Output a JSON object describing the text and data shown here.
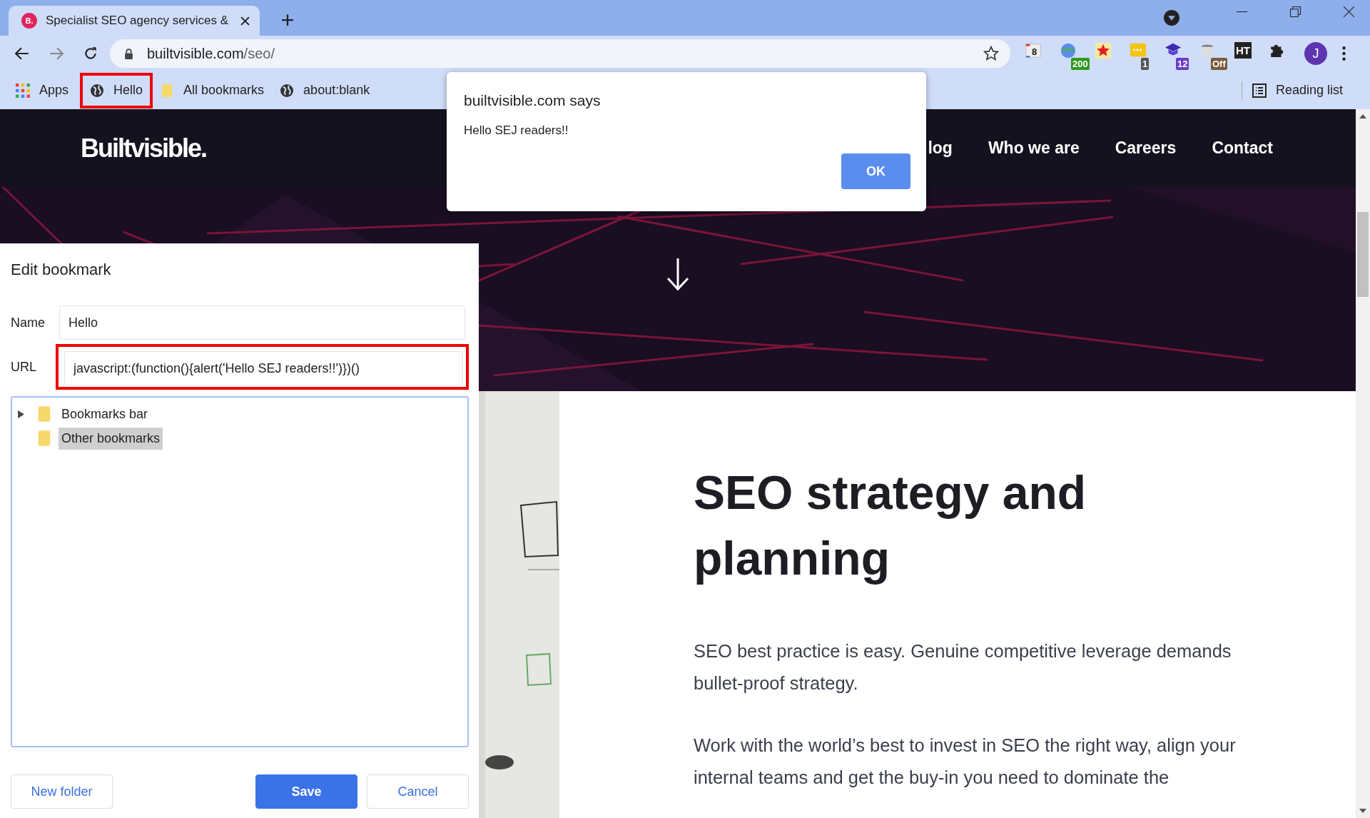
{
  "tabs": [
    {
      "favicon": "B.",
      "title": "Specialist SEO agency services &",
      "selected": true
    }
  ],
  "address_bar": {
    "domain": "builtvisible.com",
    "path": "/seo/"
  },
  "extensions": [
    {
      "kind": "calendar",
      "badge": "8"
    },
    {
      "kind": "globe",
      "badge": "200"
    },
    {
      "kind": "star"
    },
    {
      "kind": "chat",
      "badge": "1"
    },
    {
      "kind": "cap",
      "badge": "12"
    },
    {
      "kind": "cup",
      "badge": "Off"
    },
    {
      "kind": "ht",
      "label": "HT"
    },
    {
      "kind": "puzzle"
    }
  ],
  "profile": {
    "initial": "J"
  },
  "bookmarks_bar": {
    "items": [
      {
        "kind": "apps",
        "label": "Apps",
        "highlighted": false
      },
      {
        "kind": "page",
        "label": "Hello",
        "highlighted": true
      },
      {
        "kind": "folder",
        "label": "All bookmarks",
        "highlighted": false
      },
      {
        "kind": "page",
        "label": "about:blank",
        "highlighted": false
      }
    ],
    "reading_list": "Reading list"
  },
  "site": {
    "logo": "Builtvisible.",
    "nav": [
      "log",
      "Who we are",
      "Careers",
      "Contact"
    ],
    "heading": "SEO strategy and planning",
    "paragraphs": [
      "SEO best practice is easy. Genuine competitive leverage demands bullet-proof strategy.",
      "Work with the world’s best to invest in SEO the right way, align your internal teams and get the buy-in you need to dominate the"
    ]
  },
  "alert": {
    "title": "builtvisible.com says",
    "message": "Hello SEJ readers!!",
    "button": "OK"
  },
  "edit_bookmark": {
    "title": "Edit bookmark",
    "fields": [
      {
        "label": "Name",
        "value": "Hello",
        "highlighted": false
      },
      {
        "label": "URL",
        "value": "javascript:(function(){alert('Hello SEJ readers!!')})()",
        "highlighted": true
      }
    ],
    "folders": [
      {
        "label": "Bookmarks bar",
        "expanded": false,
        "selected": false
      },
      {
        "label": "Other bookmarks",
        "selected": true
      }
    ],
    "buttons": [
      {
        "label": "New folder",
        "kind": "secondary"
      },
      {
        "label": "Save",
        "kind": "primary"
      },
      {
        "label": "Cancel",
        "kind": "secondary"
      }
    ]
  }
}
